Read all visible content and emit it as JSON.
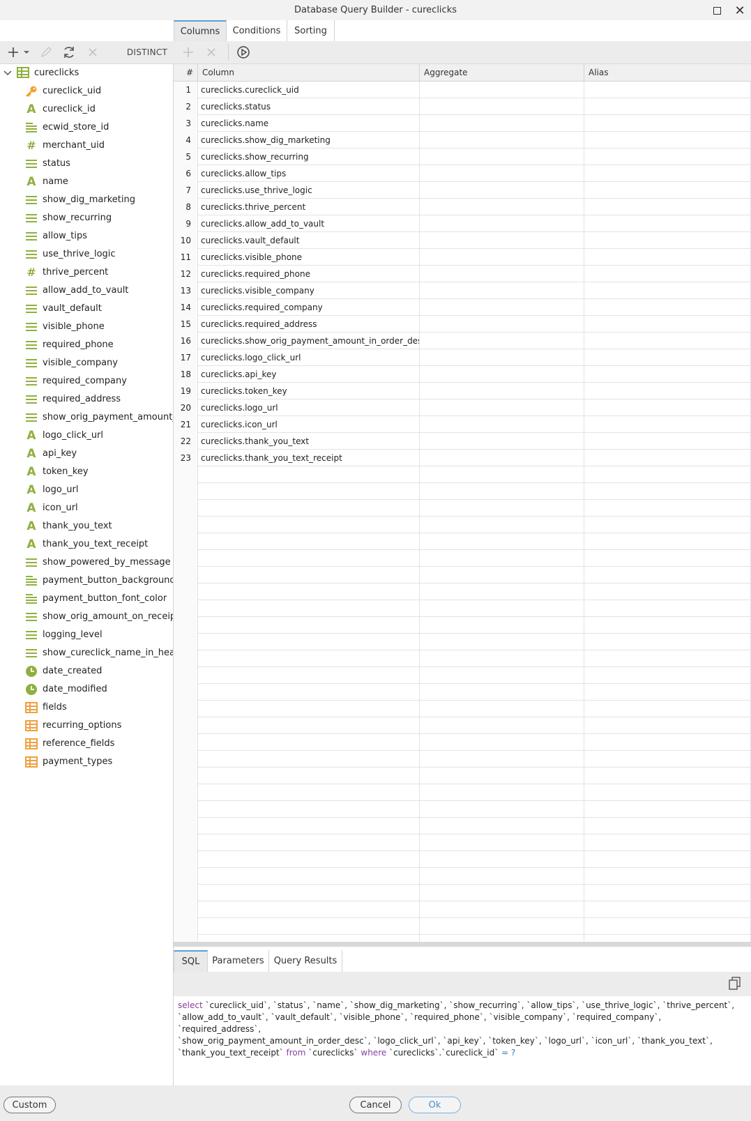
{
  "window": {
    "title": "Database Query Builder - cureclicks"
  },
  "tabs": [
    {
      "label": "Columns"
    },
    {
      "label": "Conditions"
    },
    {
      "label": "Sorting"
    }
  ],
  "toolbar": {
    "distinct_label": "DISTINCT"
  },
  "tree": {
    "root": "cureclicks",
    "items": [
      {
        "label": "cureclick_uid",
        "icon": "key-icon"
      },
      {
        "label": "cureclick_id",
        "icon": "text-type-icon"
      },
      {
        "label": "ecwid_store_id",
        "icon": "text-lines-icon"
      },
      {
        "label": "merchant_uid",
        "icon": "number-type-icon"
      },
      {
        "label": "status",
        "icon": "equal-lines-icon"
      },
      {
        "label": "name",
        "icon": "text-type-icon"
      },
      {
        "label": "show_dig_marketing",
        "icon": "equal-lines-icon"
      },
      {
        "label": "show_recurring",
        "icon": "equal-lines-icon"
      },
      {
        "label": "allow_tips",
        "icon": "equal-lines-icon"
      },
      {
        "label": "use_thrive_logic",
        "icon": "equal-lines-icon"
      },
      {
        "label": "thrive_percent",
        "icon": "number-type-icon"
      },
      {
        "label": "allow_add_to_vault",
        "icon": "equal-lines-icon"
      },
      {
        "label": "vault_default",
        "icon": "equal-lines-icon"
      },
      {
        "label": "visible_phone",
        "icon": "equal-lines-icon"
      },
      {
        "label": "required_phone",
        "icon": "equal-lines-icon"
      },
      {
        "label": "visible_company",
        "icon": "equal-lines-icon"
      },
      {
        "label": "required_company",
        "icon": "equal-lines-icon"
      },
      {
        "label": "required_address",
        "icon": "equal-lines-icon"
      },
      {
        "label": "show_orig_payment_amount_in_order_desc",
        "icon": "equal-lines-icon"
      },
      {
        "label": "logo_click_url",
        "icon": "text-type-icon"
      },
      {
        "label": "api_key",
        "icon": "text-type-icon"
      },
      {
        "label": "token_key",
        "icon": "text-type-icon"
      },
      {
        "label": "logo_url",
        "icon": "text-type-icon"
      },
      {
        "label": "icon_url",
        "icon": "text-type-icon"
      },
      {
        "label": "thank_you_text",
        "icon": "text-type-icon"
      },
      {
        "label": "thank_you_text_receipt",
        "icon": "text-type-icon"
      },
      {
        "label": "show_powered_by_message",
        "icon": "equal-lines-icon"
      },
      {
        "label": "payment_button_background_color",
        "icon": "text-lines-icon"
      },
      {
        "label": "payment_button_font_color",
        "icon": "text-lines-icon"
      },
      {
        "label": "show_orig_amount_on_receipt",
        "icon": "equal-lines-icon"
      },
      {
        "label": "logging_level",
        "icon": "equal-lines-icon"
      },
      {
        "label": "show_cureclick_name_in_header",
        "icon": "equal-lines-icon"
      },
      {
        "label": "date_created",
        "icon": "clock-icon"
      },
      {
        "label": "date_modified",
        "icon": "clock-icon"
      },
      {
        "label": "fields",
        "icon": "table-icon"
      },
      {
        "label": "recurring_options",
        "icon": "table-icon"
      },
      {
        "label": "reference_fields",
        "icon": "table-icon"
      },
      {
        "label": "payment_types",
        "icon": "table-icon"
      }
    ]
  },
  "grid": {
    "headers": [
      "#",
      "Column",
      "Aggregate",
      "Alias"
    ],
    "rows": [
      {
        "n": "1",
        "column": "cureclicks.cureclick_uid",
        "aggregate": "",
        "alias": ""
      },
      {
        "n": "2",
        "column": "cureclicks.status",
        "aggregate": "",
        "alias": ""
      },
      {
        "n": "3",
        "column": "cureclicks.name",
        "aggregate": "",
        "alias": ""
      },
      {
        "n": "4",
        "column": "cureclicks.show_dig_marketing",
        "aggregate": "",
        "alias": ""
      },
      {
        "n": "5",
        "column": "cureclicks.show_recurring",
        "aggregate": "",
        "alias": ""
      },
      {
        "n": "6",
        "column": "cureclicks.allow_tips",
        "aggregate": "",
        "alias": ""
      },
      {
        "n": "7",
        "column": "cureclicks.use_thrive_logic",
        "aggregate": "",
        "alias": ""
      },
      {
        "n": "8",
        "column": "cureclicks.thrive_percent",
        "aggregate": "",
        "alias": ""
      },
      {
        "n": "9",
        "column": "cureclicks.allow_add_to_vault",
        "aggregate": "",
        "alias": ""
      },
      {
        "n": "10",
        "column": "cureclicks.vault_default",
        "aggregate": "",
        "alias": ""
      },
      {
        "n": "11",
        "column": "cureclicks.visible_phone",
        "aggregate": "",
        "alias": ""
      },
      {
        "n": "12",
        "column": "cureclicks.required_phone",
        "aggregate": "",
        "alias": ""
      },
      {
        "n": "13",
        "column": "cureclicks.visible_company",
        "aggregate": "",
        "alias": ""
      },
      {
        "n": "14",
        "column": "cureclicks.required_company",
        "aggregate": "",
        "alias": ""
      },
      {
        "n": "15",
        "column": "cureclicks.required_address",
        "aggregate": "",
        "alias": ""
      },
      {
        "n": "16",
        "column": "cureclicks.show_orig_payment_amount_in_order_desc",
        "aggregate": "",
        "alias": ""
      },
      {
        "n": "17",
        "column": "cureclicks.logo_click_url",
        "aggregate": "",
        "alias": ""
      },
      {
        "n": "18",
        "column": "cureclicks.api_key",
        "aggregate": "",
        "alias": ""
      },
      {
        "n": "19",
        "column": "cureclicks.token_key",
        "aggregate": "",
        "alias": ""
      },
      {
        "n": "20",
        "column": "cureclicks.logo_url",
        "aggregate": "",
        "alias": ""
      },
      {
        "n": "21",
        "column": "cureclicks.icon_url",
        "aggregate": "",
        "alias": ""
      },
      {
        "n": "22",
        "column": "cureclicks.thank_you_text",
        "aggregate": "",
        "alias": ""
      },
      {
        "n": "23",
        "column": "cureclicks.thank_you_text_receipt",
        "aggregate": "",
        "alias": ""
      }
    ]
  },
  "bottom_tabs": [
    {
      "label": "SQL"
    },
    {
      "label": "Parameters"
    },
    {
      "label": "Query Results"
    }
  ],
  "sql": {
    "kw_select": "select",
    "fields_line1": "`cureclick_uid`, `status`, `name`, `show_dig_marketing`, `show_recurring`, `allow_tips`, `use_thrive_logic`, `thrive_percent`,",
    "fields_line2": "`allow_add_to_vault`, `vault_default`, `visible_phone`, `required_phone`, `visible_company`, `required_company`, `required_address`,",
    "fields_line3": "`show_orig_payment_amount_in_order_desc`, `logo_click_url`, `api_key`, `token_key`, `logo_url`, `icon_url`, `thank_you_text`,",
    "fields_line4": "`thank_you_text_receipt`",
    "kw_from": "from",
    "table": "`cureclicks`",
    "kw_where": "where",
    "condition": "`cureclicks`.`cureclick_id`",
    "operator": "= ?"
  },
  "footer": {
    "custom_label": "Custom",
    "cancel_label": "Cancel",
    "ok_label": "Ok"
  },
  "colors": {
    "accent": "#5aa0d8",
    "type_green": "#8fb03e",
    "key_orange": "#f0a030",
    "table_orange": "#f0a040"
  }
}
